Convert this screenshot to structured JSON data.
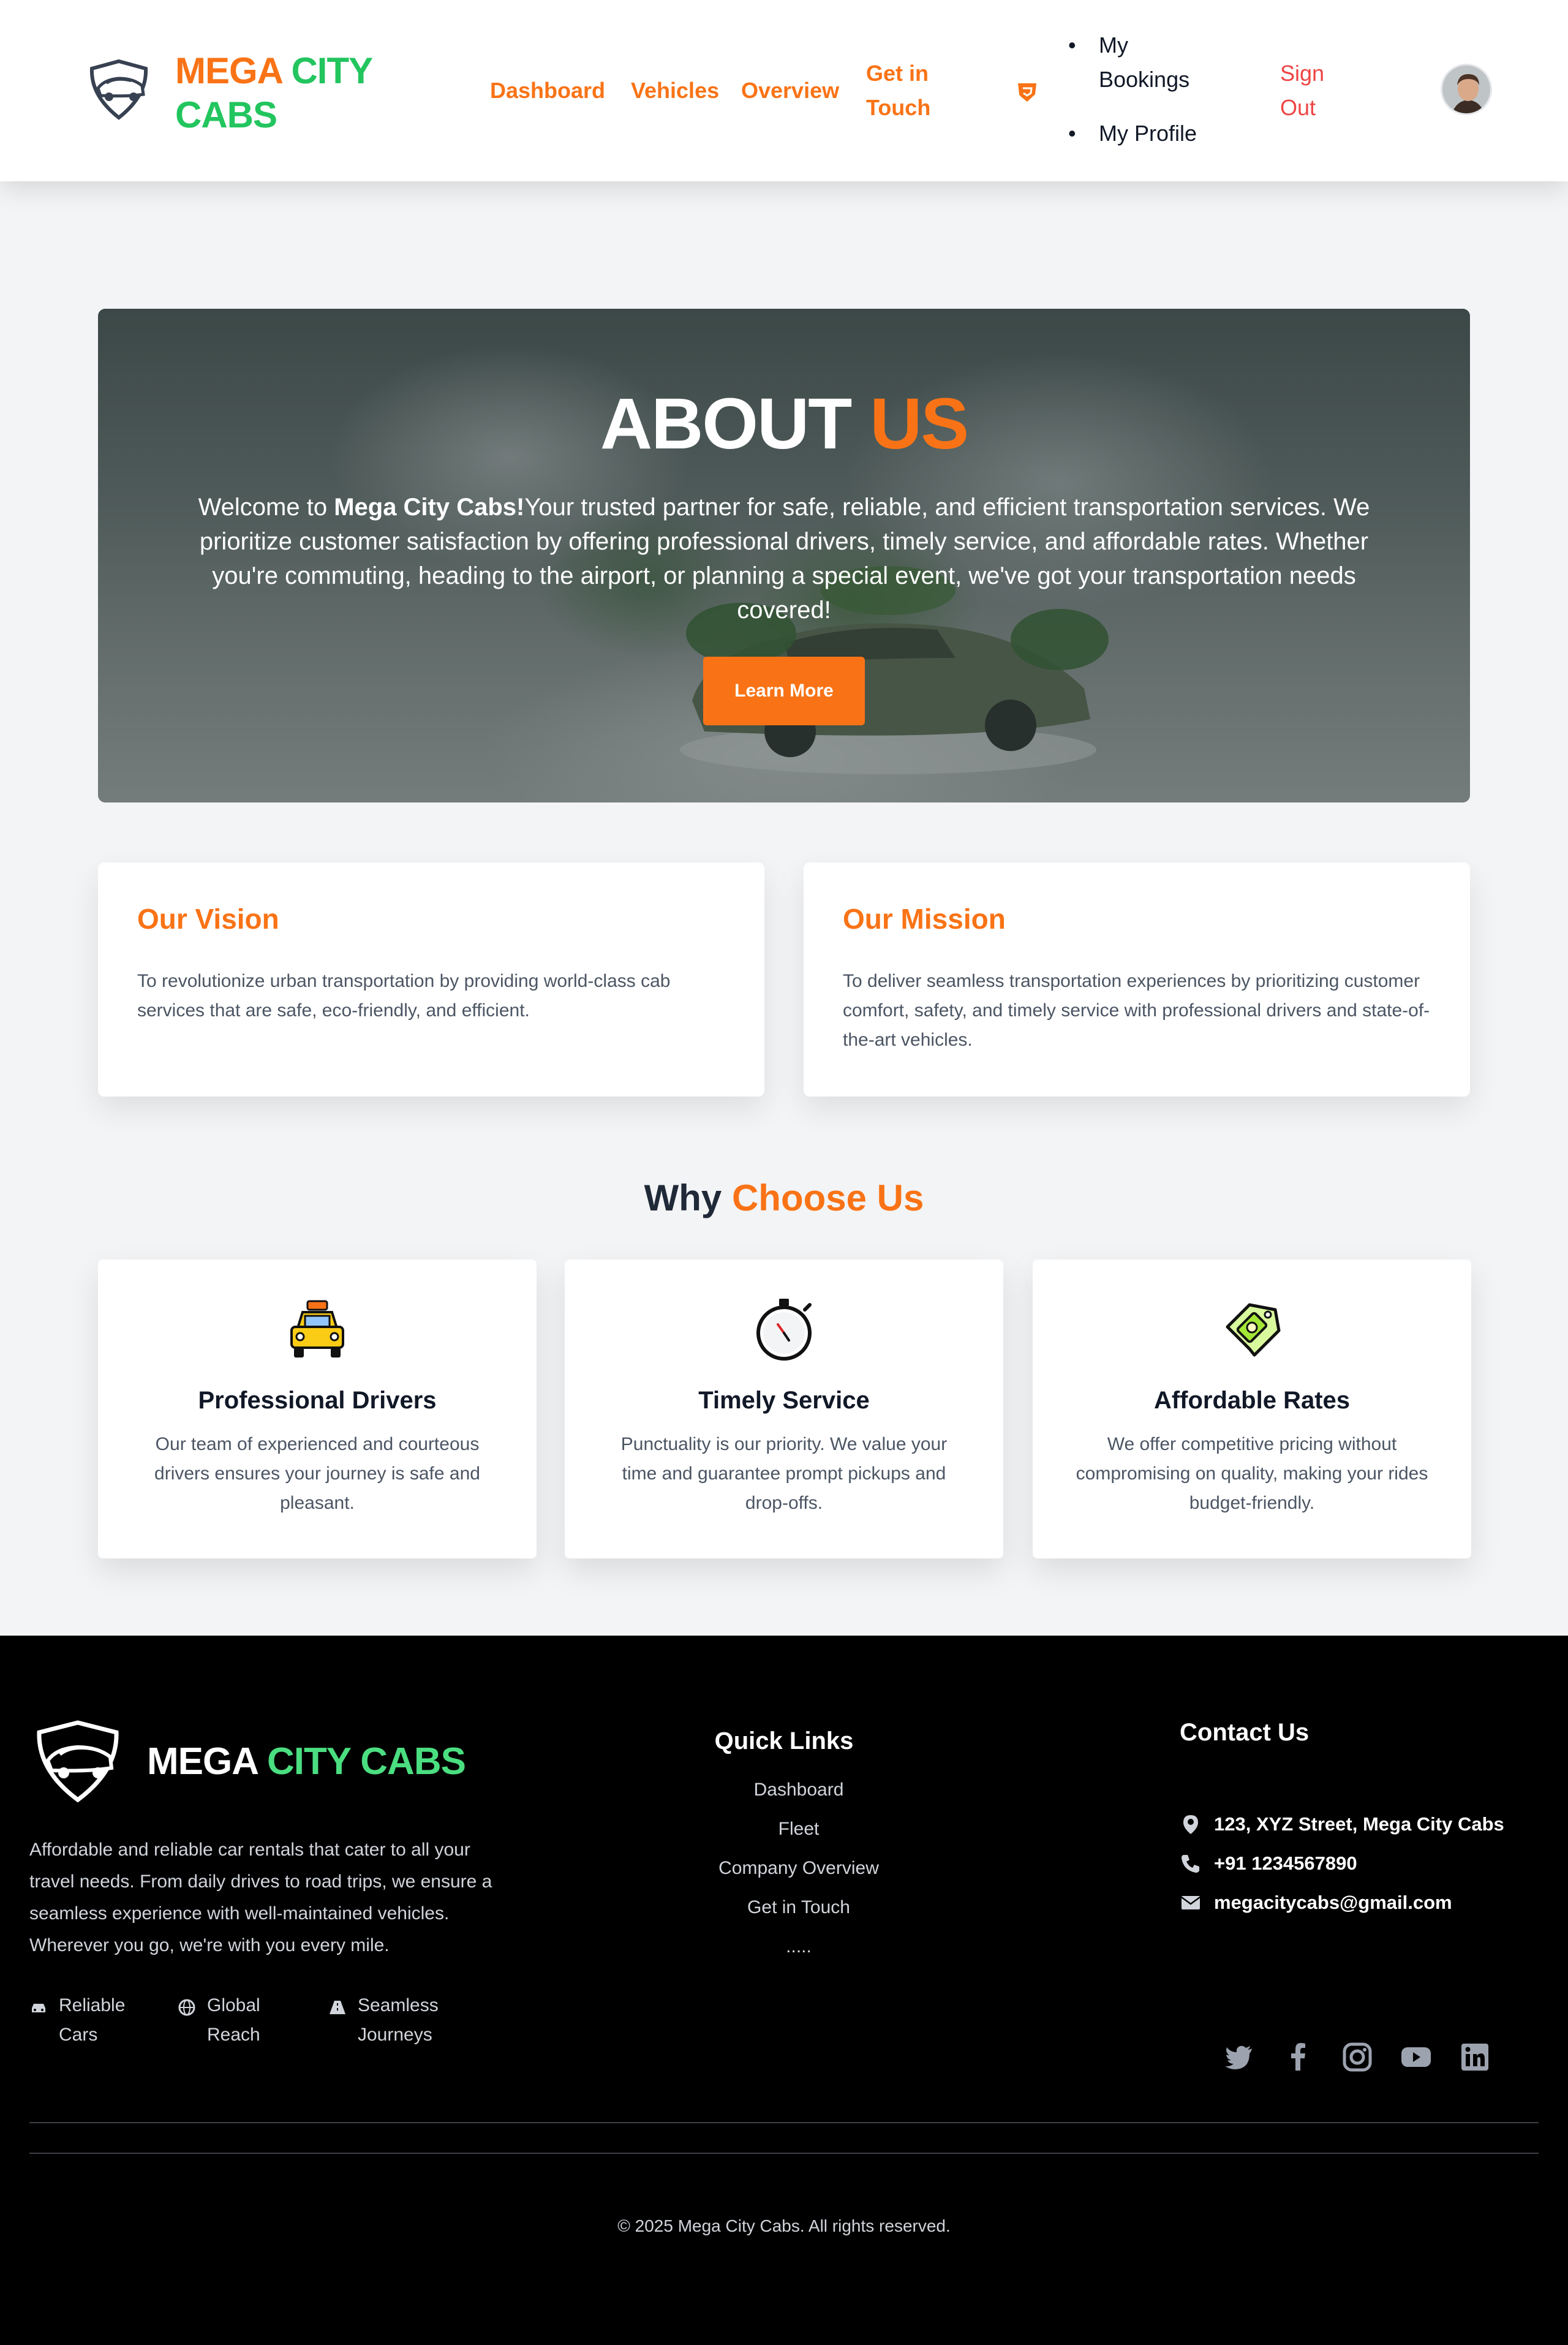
{
  "navbar": {
    "brand": {
      "word1": "MEGA",
      "word2": "CITY",
      "word3": "CABS"
    },
    "links": [
      "Dashboard",
      "Vehicles",
      "Overview",
      "Get in Touch"
    ],
    "menu": [
      "My Bookings",
      "My Profile"
    ],
    "signout": "Sign Out",
    "icons": {
      "logo": "car-shield-logo",
      "shield": "shield-icon",
      "avatar": "user-avatar"
    }
  },
  "hero": {
    "title_white": "ABOUT",
    "title_orange": "US",
    "text_prefix": "Welcome to ",
    "text_bold": "Mega City Cabs!",
    "text_body": "Your trusted partner for safe, reliable, and efficient transportation services. We prioritize customer satisfaction by offering professional drivers, timely service, and affordable rates. Whether you're commuting, heading to the airport, or planning a special event, we've got your transportation needs covered!",
    "button": "Learn More"
  },
  "vision": {
    "title": "Our Vision",
    "text": "To revolutionize urban transportation by providing world-class cab services that are safe, eco-friendly, and efficient."
  },
  "mission": {
    "title": "Our Mission",
    "text": "To deliver seamless transportation experiences by prioritizing customer comfort, safety, and timely service with professional drivers and state-of-the-art vehicles."
  },
  "why": {
    "title_dark": "Why",
    "title_orange": "Choose Us",
    "features": [
      {
        "icon": "taxi-icon",
        "title": "Professional Drivers",
        "text": "Our team of experienced and courteous drivers ensures your journey is safe and pleasant."
      },
      {
        "icon": "stopwatch-icon",
        "title": "Timely Service",
        "text": "Punctuality is our priority. We value your time and guarantee prompt pickups and drop-offs."
      },
      {
        "icon": "money-tag-icon",
        "title": "Affordable Rates",
        "text": "We offer competitive pricing without compromising on quality, making your rides budget-friendly."
      }
    ]
  },
  "footer": {
    "brand": {
      "word1": "MEGA",
      "word2": "CITY CABS"
    },
    "description": "Affordable and reliable car rentals that cater to all your travel needs. From daily drives to road trips, we ensure a seamless experience with well-maintained vehicles. Wherever you go, we're with you every mile.",
    "badges": [
      "Reliable Cars",
      "Global Reach",
      "Seamless Journeys"
    ],
    "quick_links_title": "Quick Links",
    "quick_links": [
      "Dashboard",
      "Fleet",
      "Company Overview",
      "Get in Touch",
      "....."
    ],
    "contact_title": "Contact Us",
    "contact": {
      "address": "123, XYZ Street, Mega City Cabs",
      "phone": "+91 1234567890",
      "email": "megacitycabs@gmail.com"
    },
    "socials": [
      "twitter-icon",
      "facebook-icon",
      "instagram-icon",
      "youtube-icon",
      "linkedin-icon"
    ],
    "copyright": "© 2025 Mega City Cabs. All rights reserved."
  },
  "colors": {
    "accent": "#f97316",
    "brand_green": "#4ade80",
    "danger": "#ef4444",
    "footer_bg": "#000000"
  }
}
